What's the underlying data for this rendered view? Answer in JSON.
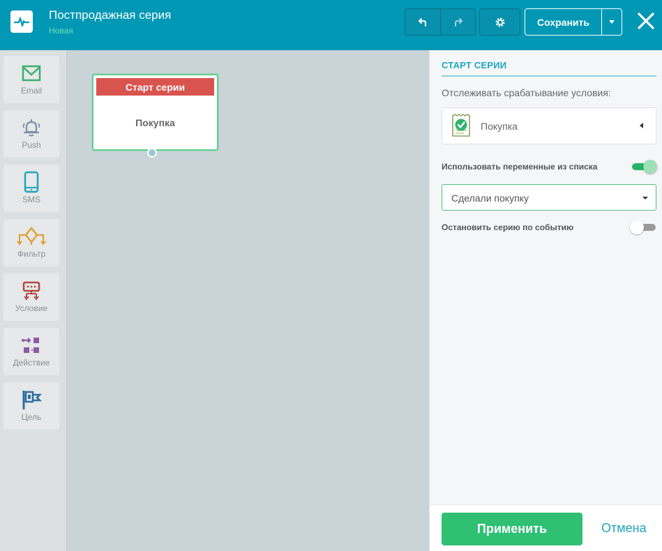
{
  "header": {
    "title": "Постпродажная серия",
    "subtitle": "Новая",
    "save_label": "Сохранить"
  },
  "palette": {
    "items": [
      {
        "label": "Email",
        "icon": "envelope-icon",
        "color": "#3bb16f"
      },
      {
        "label": "Push",
        "icon": "bell-icon",
        "color": "#7b8fa8"
      },
      {
        "label": "SMS",
        "icon": "phone-icon",
        "color": "#22a4b7"
      },
      {
        "label": "Фильтр",
        "icon": "filter-icon",
        "color": "#e0a036"
      },
      {
        "label": "Условие",
        "icon": "condition-icon",
        "color": "#b5473f"
      },
      {
        "label": "Действие",
        "icon": "action-icon",
        "color": "#8e5aa5"
      },
      {
        "label": "Цель",
        "icon": "goal-flag-icon",
        "color": "#2c6f9e"
      }
    ]
  },
  "canvas": {
    "node": {
      "header": "Старт серии",
      "body": "Покупка",
      "header_color": "#d9534f",
      "border_color": "#5ed08e"
    }
  },
  "panel": {
    "title": "СТАРТ СЕРИИ",
    "track_label": "Отслеживать срабатывание условия:",
    "event_value": "Покупка",
    "use_vars_label": "Использовать переменные из списка",
    "use_vars_on": true,
    "variable_value": "Сделали покупку",
    "stop_label": "Остановить серию по событию",
    "stop_on": false,
    "apply_label": "Применить",
    "cancel_label": "Отмена"
  },
  "colors": {
    "header_bg": "#0098b5",
    "accent": "#1fa6bf",
    "apply": "#2fc073"
  }
}
